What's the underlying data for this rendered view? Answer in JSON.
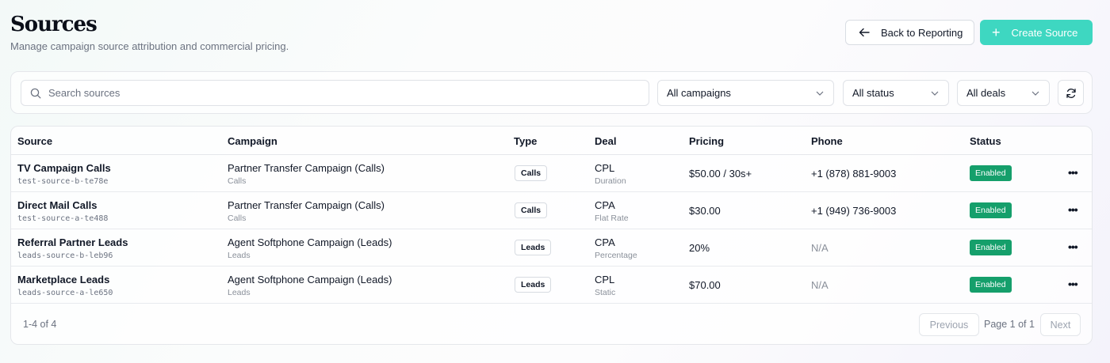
{
  "header": {
    "title": "Sources",
    "subtitle": "Manage campaign source attribution and commercial pricing.",
    "back_label": "Back to Reporting",
    "create_label": "Create Source"
  },
  "filters": {
    "search_placeholder": "Search sources",
    "campaigns": "All campaigns",
    "status": "All status",
    "deals": "All deals"
  },
  "table": {
    "columns": [
      "Source",
      "Campaign",
      "Type",
      "Deal",
      "Pricing",
      "Phone",
      "Status"
    ],
    "rows": [
      {
        "source": "TV Campaign Calls",
        "slug": "test-source-b-te78e",
        "campaign": "Partner Transfer Campaign (Calls)",
        "campaign_type": "Calls",
        "type": "Calls",
        "deal": "CPL",
        "deal_sub": "Duration",
        "pricing": "$50.00 / 30s+",
        "phone": "+1 (878) 881-9003",
        "status": "Enabled"
      },
      {
        "source": "Direct Mail Calls",
        "slug": "test-source-a-te488",
        "campaign": "Partner Transfer Campaign (Calls)",
        "campaign_type": "Calls",
        "type": "Calls",
        "deal": "CPA",
        "deal_sub": "Flat Rate",
        "pricing": "$30.00",
        "phone": "+1 (949) 736-9003",
        "status": "Enabled"
      },
      {
        "source": "Referral Partner Leads",
        "slug": "leads-source-b-leb96",
        "campaign": "Agent Softphone Campaign (Leads)",
        "campaign_type": "Leads",
        "type": "Leads",
        "deal": "CPA",
        "deal_sub": "Percentage",
        "pricing": "20%",
        "phone": "N/A",
        "status": "Enabled"
      },
      {
        "source": "Marketplace Leads",
        "slug": "leads-source-a-le650",
        "campaign": "Agent Softphone Campaign (Leads)",
        "campaign_type": "Leads",
        "type": "Leads",
        "deal": "CPL",
        "deal_sub": "Static",
        "pricing": "$70.00",
        "phone": "N/A",
        "status": "Enabled"
      }
    ]
  },
  "pagination": {
    "count": "1-4 of 4",
    "previous": "Previous",
    "page": "Page 1 of 1",
    "next": "Next"
  },
  "colors": {
    "accent": "#3ed7c1",
    "enabled": "#159f6b"
  }
}
